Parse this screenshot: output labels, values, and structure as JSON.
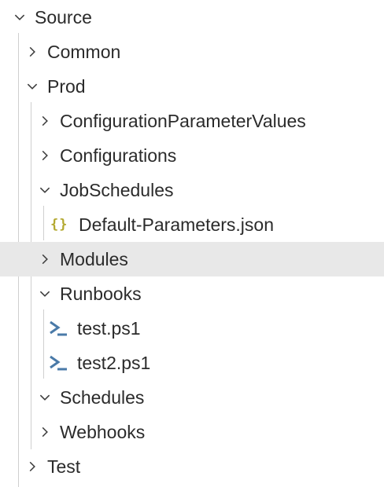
{
  "explorer": {
    "source": {
      "label": "Source",
      "state": "expanded"
    },
    "common": {
      "label": "Common",
      "state": "collapsed"
    },
    "prod": {
      "label": "Prod",
      "state": "expanded"
    },
    "configuration_parameter_values": {
      "label": "ConfigurationParameterValues",
      "state": "collapsed"
    },
    "configurations": {
      "label": "Configurations",
      "state": "collapsed"
    },
    "job_schedules": {
      "label": "JobSchedules",
      "state": "expanded"
    },
    "default_parameters": {
      "label": "Default-Parameters.json",
      "icon": "json-braces-icon",
      "icon_glyph": "{}",
      "icon_color": "#b3a82f"
    },
    "modules": {
      "label": "Modules",
      "state": "collapsed",
      "hovered": true
    },
    "runbooks": {
      "label": "Runbooks",
      "state": "expanded"
    },
    "test_ps1": {
      "label": "test.ps1",
      "icon": "powershell-icon",
      "icon_color": "#4a7aa8"
    },
    "test2_ps1": {
      "label": "test2.ps1",
      "icon": "powershell-icon",
      "icon_color": "#4a7aa8"
    },
    "schedules": {
      "label": "Schedules",
      "state": "expanded"
    },
    "webhooks": {
      "label": "Webhooks",
      "state": "collapsed"
    },
    "test": {
      "label": "Test",
      "state": "collapsed"
    }
  },
  "colors": {
    "hover_background": "#e8e8e8",
    "indent_guide": "#cfcfcf",
    "text": "#2b2b2b"
  }
}
